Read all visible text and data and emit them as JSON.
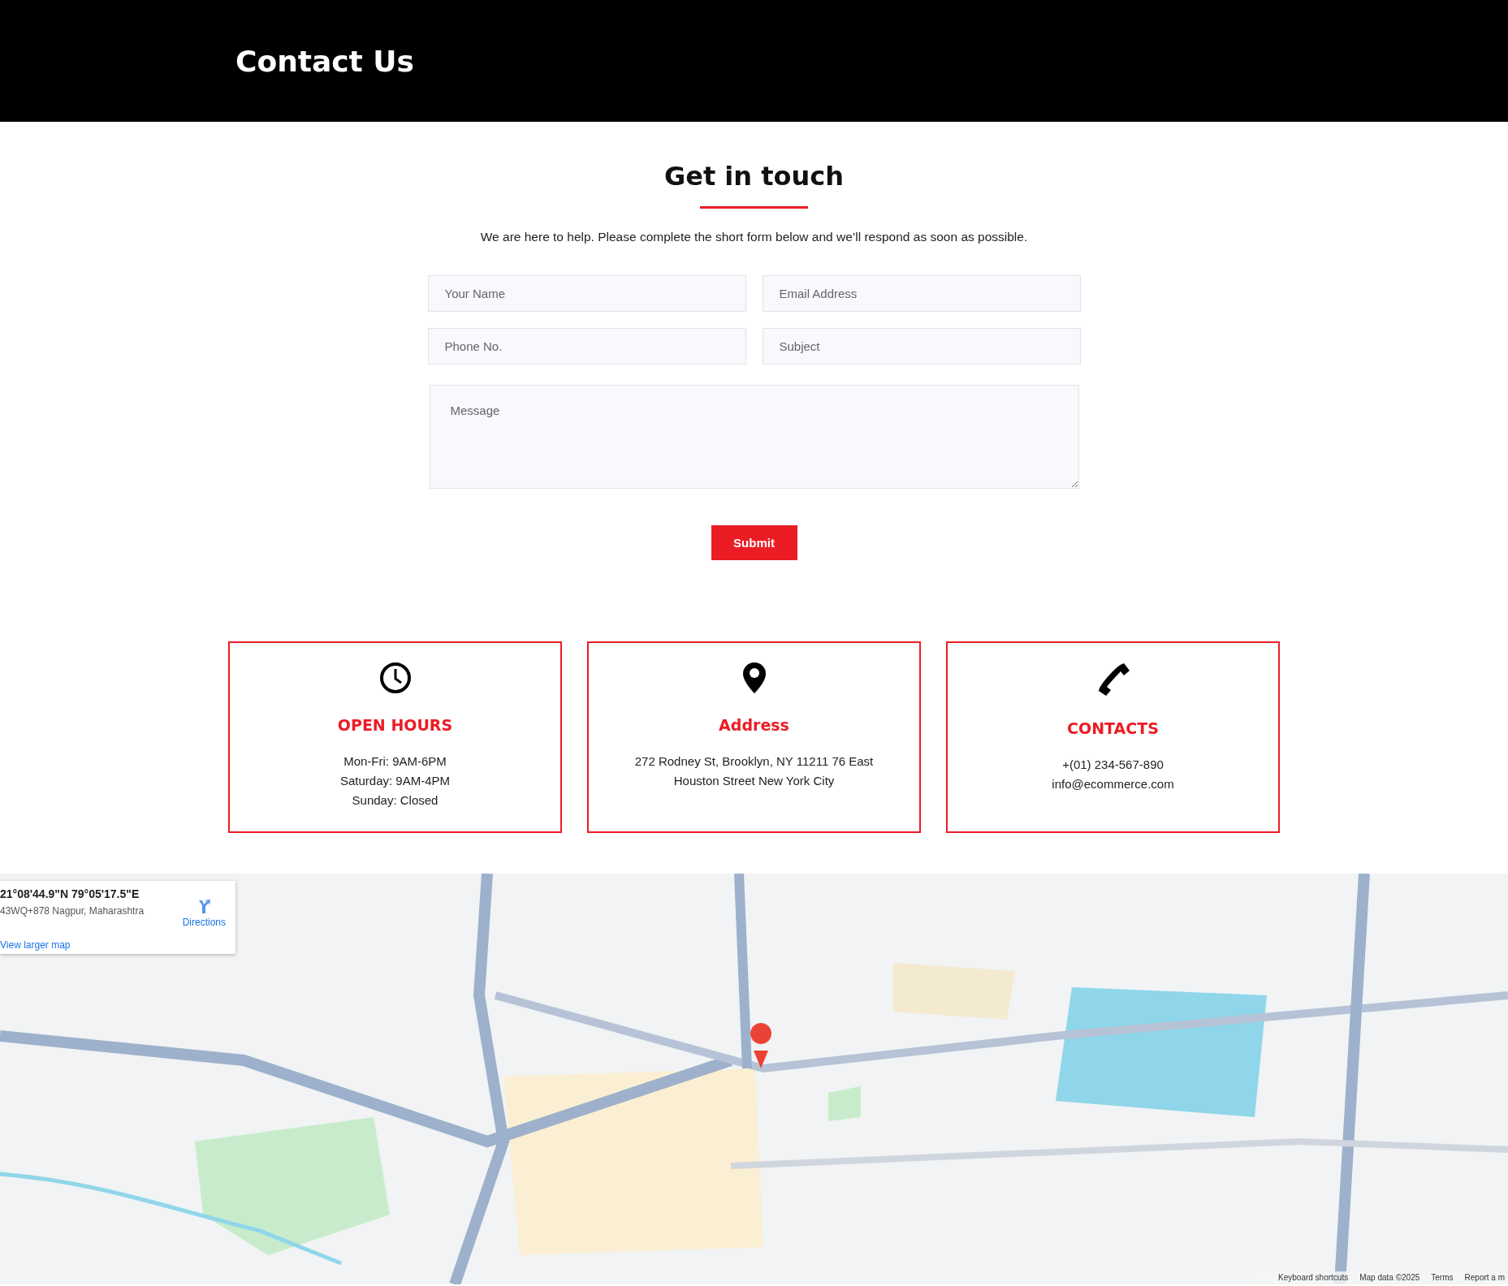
{
  "header": {
    "title": "Contact Us"
  },
  "contact_section": {
    "heading": "Get in touch",
    "intro": "We are here to help. Please complete the short form below and we’ll respond as soon as possible.",
    "fields": [
      {
        "placeholder": "Your Name"
      },
      {
        "placeholder": "Email Address"
      },
      {
        "placeholder": "Phone No."
      },
      {
        "placeholder": "Subject"
      }
    ],
    "message": {
      "placeholder": "Message"
    },
    "submit_button": "Submit"
  },
  "info_cards": [
    {
      "kind": "clock",
      "title": "OPEN HOURS",
      "lines": [
        "Mon-Fri: 9AM-6PM",
        "Saturday: 9AM-4PM",
        "Sunday: Closed"
      ]
    },
    {
      "kind": "pin",
      "title": "Address",
      "lines": [
        "272 Rodney St, Brooklyn, NY 11211 76 East Houston Street New York City"
      ]
    },
    {
      "kind": "phone",
      "title": "CONTACTS",
      "lines": [
        "+(01) 234-567-890",
        "info@ecommerce.com"
      ]
    }
  ],
  "map": {
    "kind": "picture",
    "place_card": {
      "coordinates": "21°08'44.9\"N 79°05'17.5\"E",
      "plus_code": "43WQ+878 Nagpur, Maharashtra",
      "directions": "Directions",
      "larger_map_link": "View larger map"
    },
    "footer_links": [
      "Keyboard shortcuts",
      "Map data ©2025",
      "Terms",
      "Report a m"
    ]
  }
}
